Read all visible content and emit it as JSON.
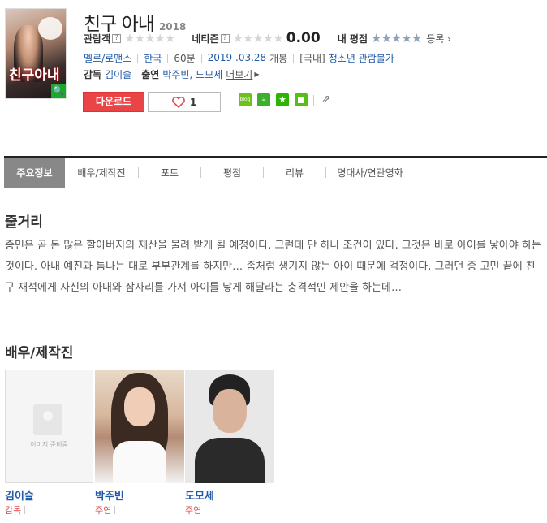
{
  "movie": {
    "title": "친구 아내",
    "year": "2018",
    "poster_title": "친구아내",
    "rating": {
      "audience_label": "관람객",
      "netizen_label": "네티즌",
      "netizen_score": "0.00",
      "my_rating_label": "내 평점",
      "register": "등록",
      "help_mark": "?"
    },
    "meta": {
      "genre": "멜로/로맨스",
      "country": "한국",
      "runtime": "60분",
      "release_date": "2019 .03.28",
      "release_suffix": "개봉",
      "rating_region": "[국내]",
      "age_rating": "청소년 관람불가"
    },
    "people": {
      "director_label": "감독",
      "director": "김이슬",
      "cast_label": "출연",
      "cast": "박주빈, 도모세",
      "more": "더보기"
    },
    "actions": {
      "download": "다운로드",
      "like_count": "1"
    }
  },
  "tabs": [
    "주요정보",
    "배우/제작진",
    "포토",
    "평점",
    "리뷰",
    "명대사/연관영화"
  ],
  "synopsis": {
    "heading": "줄거리",
    "text": "종민은 곧 돈 많은 할아버지의 재산을 물려 받게 될 예정이다. 그런데 단 하나 조건이 있다. 그것은 바로 아이를 낳아야 하는 것이다. 아내 예진과 틈나는 대로 부부관계를 하지만… 좀처럼 생기지 않는 아이 때문에 걱정이다. 그러던 중 고민 끝에 친구 재석에게 자신의 아내와 잠자리를 가져 아이를 낳게 해달라는 충격적인 제안을 하는데…"
  },
  "cast_section": {
    "heading": "배우/제작진",
    "no_image_text": "이미지 준비중",
    "members": [
      {
        "name": "김이슬",
        "role": "감독"
      },
      {
        "name": "박주빈",
        "role": "주연"
      },
      {
        "name": "도모세",
        "role": "주연"
      }
    ]
  }
}
